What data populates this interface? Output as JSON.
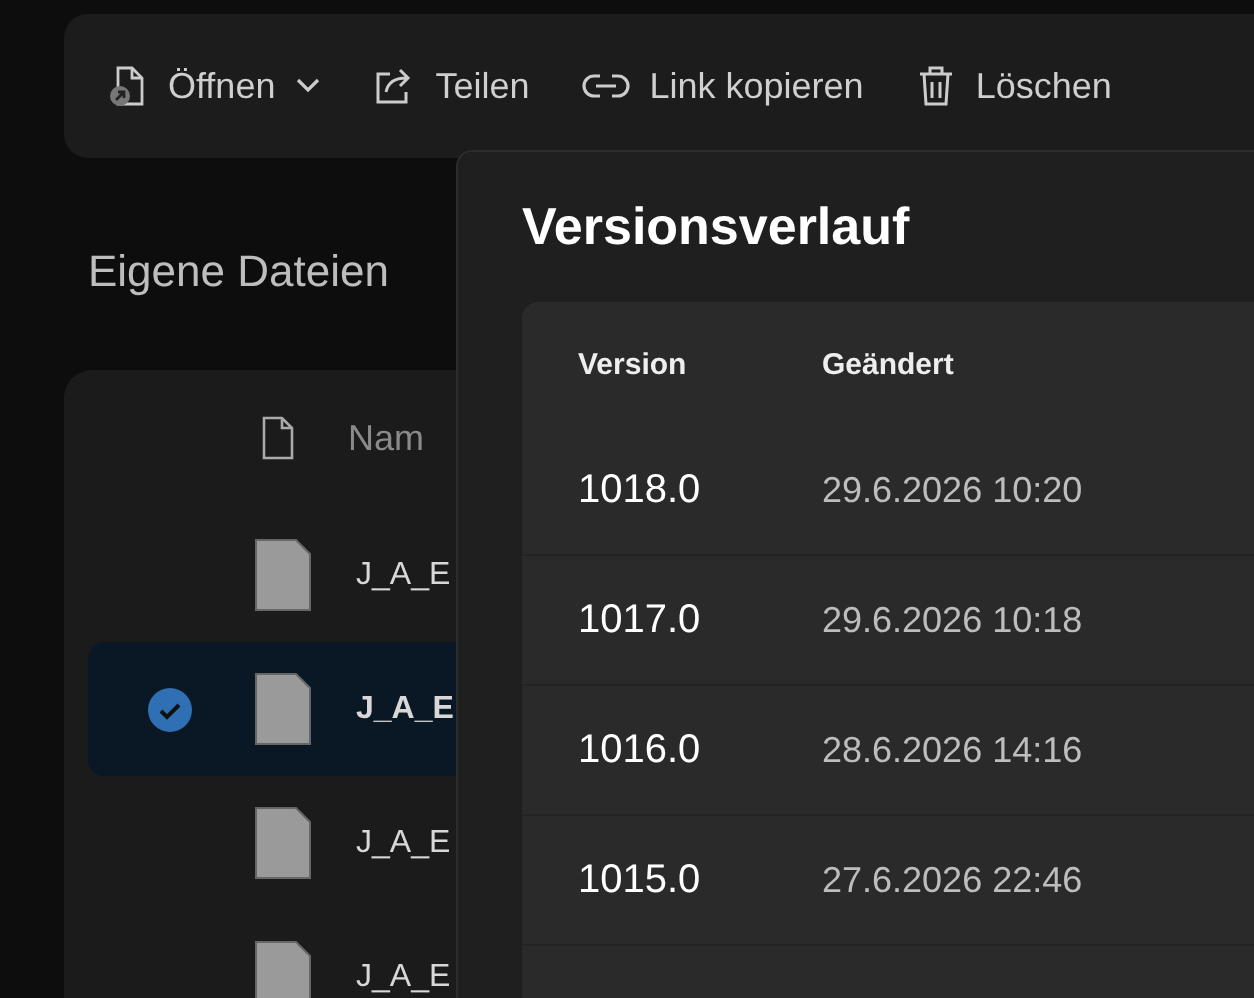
{
  "toolbar": [
    {
      "kind": "open",
      "label": "Öffnen",
      "dropdown": true
    },
    {
      "kind": "share",
      "label": "Teilen",
      "dropdown": false
    },
    {
      "kind": "link",
      "label": "Link kopieren",
      "dropdown": false
    },
    {
      "kind": "delete",
      "label": "Löschen",
      "dropdown": false
    }
  ],
  "page_title": "Eigene Dateien",
  "file_list": {
    "columns": [
      "Nam"
    ],
    "rows": [
      {
        "name": "J_A_E",
        "selected": false
      },
      {
        "name": "J_A_E",
        "selected": true
      },
      {
        "name": "J_A_E",
        "selected": false
      },
      {
        "name": "J_A_E",
        "selected": false
      }
    ]
  },
  "dialog": {
    "title": "Versionsverlauf",
    "columns": [
      "Version",
      "Geändert"
    ],
    "rows": [
      {
        "version": "1018.0",
        "changed": "29.6.2026 10:20"
      },
      {
        "version": "1017.0",
        "changed": "29.6.2026 10:18"
      },
      {
        "version": "1016.0",
        "changed": "28.6.2026 14:16"
      },
      {
        "version": "1015.0",
        "changed": "27.6.2026 22:46"
      }
    ]
  }
}
